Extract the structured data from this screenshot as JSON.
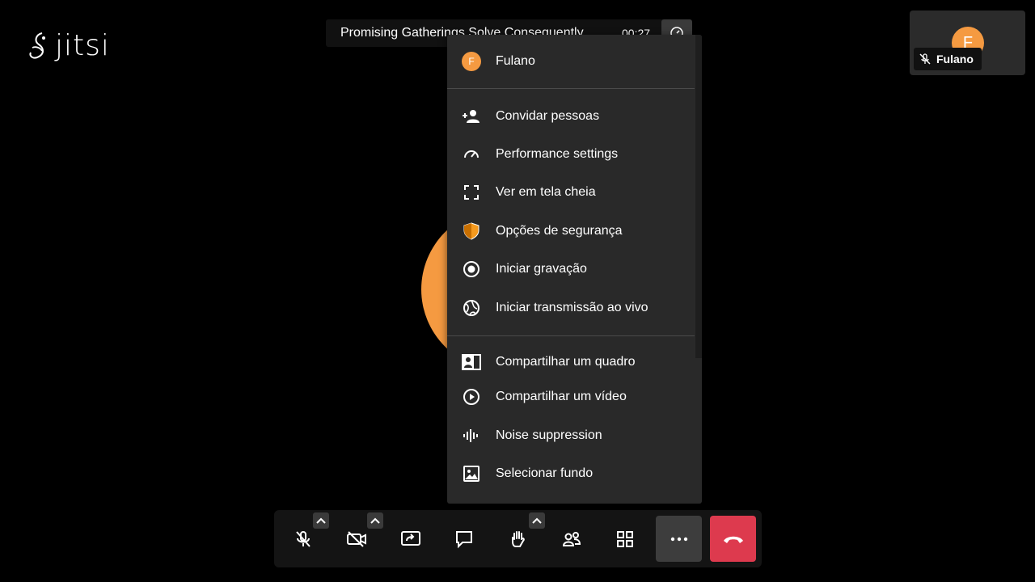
{
  "logo": {
    "text": "jitsi"
  },
  "header": {
    "title": "Promising Gatherings Solve Consequently",
    "timer": "00:27"
  },
  "thumbnail": {
    "initial": "F",
    "name": "Fulano"
  },
  "menu": {
    "user": {
      "initial": "F",
      "name": "Fulano"
    },
    "items": [
      {
        "label": "Convidar pessoas",
        "icon": "invite-icon"
      },
      {
        "label": "Performance settings",
        "icon": "gauge-icon"
      },
      {
        "label": "Ver em tela cheia",
        "icon": "fullscreen-icon"
      },
      {
        "label": "Opções de segurança",
        "icon": "shield-icon"
      },
      {
        "label": "Iniciar gravação",
        "icon": "record-icon"
      },
      {
        "label": "Iniciar transmissão ao vivo",
        "icon": "globe-icon"
      },
      {
        "label": "Compartilhar um quadro",
        "icon": "whiteboard-icon"
      },
      {
        "label": "Compartilhar um vídeo",
        "icon": "play-icon"
      },
      {
        "label": "Noise suppression",
        "icon": "waveform-icon"
      },
      {
        "label": "Selecionar fundo",
        "icon": "image-icon"
      }
    ]
  },
  "toolbar": {
    "buttons": [
      "mic-muted-icon",
      "camera-off-icon",
      "screenshare-icon",
      "chat-icon",
      "raise-hand-icon",
      "participants-icon",
      "tile-view-icon",
      "more-icon",
      "hangup-icon"
    ]
  },
  "colors": {
    "accent": "#f59a41",
    "hangup": "#dd3a4e",
    "menu_bg": "#292929",
    "shield": "#f59a1e"
  }
}
